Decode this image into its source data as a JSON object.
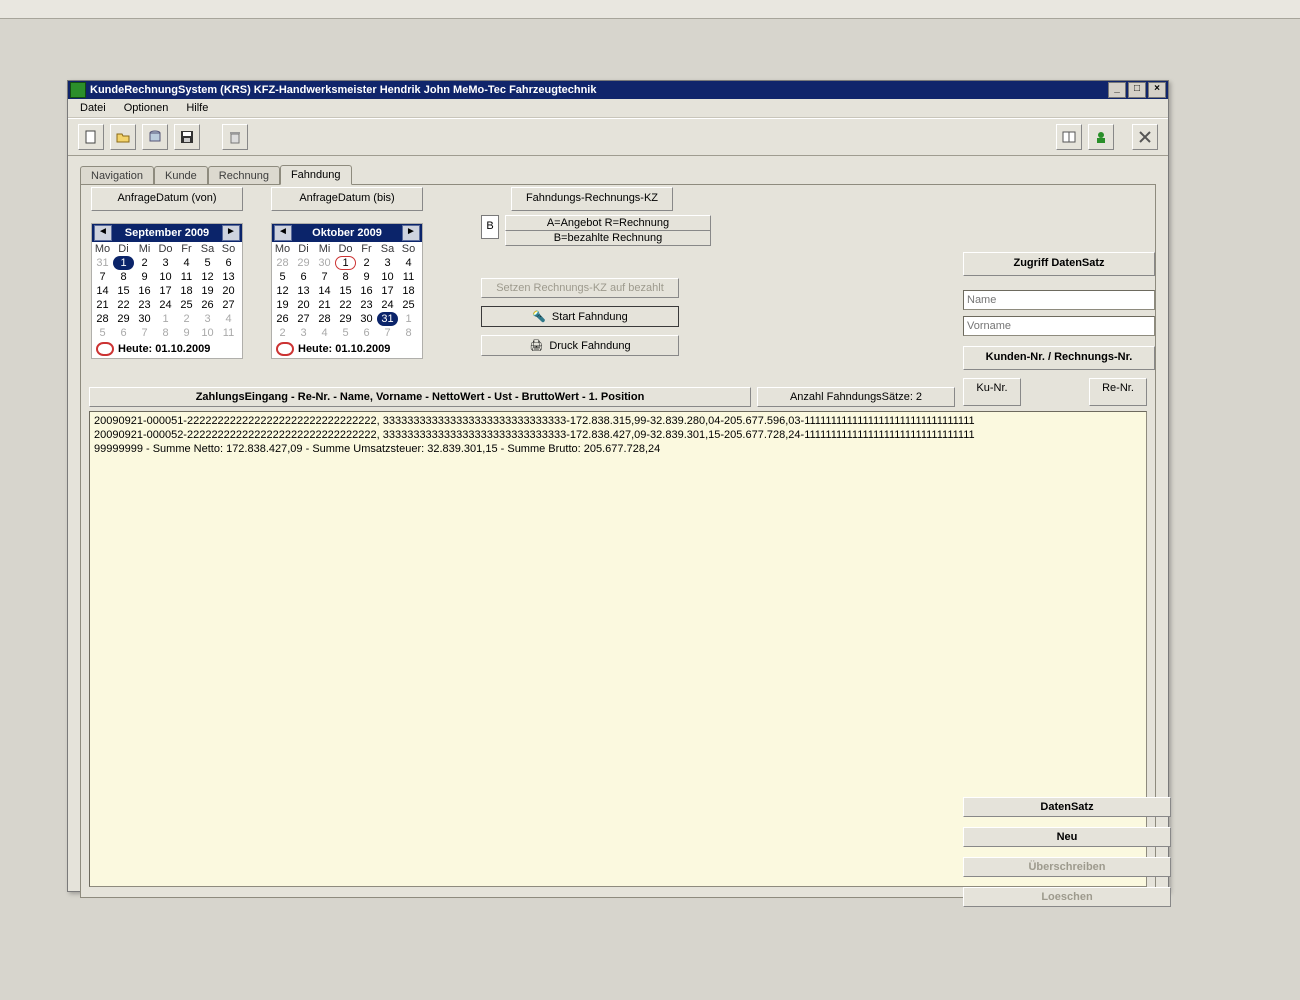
{
  "title": "KundeRechnungSystem (KRS)   KFZ-Handwerksmeister   Hendrik John   MeMo-Tec Fahrzeugtechnik",
  "menu": {
    "datei": "Datei",
    "optionen": "Optionen",
    "hilfe": "Hilfe"
  },
  "tabs": {
    "nav": "Navigation",
    "kunde": "Kunde",
    "rechnung": "Rechnung",
    "fahndung": "Fahndung"
  },
  "von_btn": "AnfrageDatum  (von)",
  "bis_btn": "AnfrageDatum  (bis)",
  "cal_von": {
    "title": "September 2009",
    "dow": [
      "Mo",
      "Di",
      "Mi",
      "Do",
      "Fr",
      "Sa",
      "So"
    ],
    "weeks": [
      [
        {
          "d": "31",
          "g": true
        },
        {
          "d": "1",
          "sel": true
        },
        {
          "d": "2"
        },
        {
          "d": "3"
        },
        {
          "d": "4"
        },
        {
          "d": "5"
        },
        {
          "d": "6"
        }
      ],
      [
        {
          "d": "7"
        },
        {
          "d": "8"
        },
        {
          "d": "9"
        },
        {
          "d": "10"
        },
        {
          "d": "11"
        },
        {
          "d": "12"
        },
        {
          "d": "13"
        }
      ],
      [
        {
          "d": "14"
        },
        {
          "d": "15"
        },
        {
          "d": "16"
        },
        {
          "d": "17"
        },
        {
          "d": "18"
        },
        {
          "d": "19"
        },
        {
          "d": "20"
        }
      ],
      [
        {
          "d": "21"
        },
        {
          "d": "22"
        },
        {
          "d": "23"
        },
        {
          "d": "24"
        },
        {
          "d": "25"
        },
        {
          "d": "26"
        },
        {
          "d": "27"
        }
      ],
      [
        {
          "d": "28"
        },
        {
          "d": "29"
        },
        {
          "d": "30"
        },
        {
          "d": "1",
          "g": true
        },
        {
          "d": "2",
          "g": true
        },
        {
          "d": "3",
          "g": true
        },
        {
          "d": "4",
          "g": true
        }
      ],
      [
        {
          "d": "5",
          "g": true
        },
        {
          "d": "6",
          "g": true
        },
        {
          "d": "7",
          "g": true
        },
        {
          "d": "8",
          "g": true
        },
        {
          "d": "9",
          "g": true
        },
        {
          "d": "10",
          "g": true
        },
        {
          "d": "11",
          "g": true
        }
      ]
    ],
    "today": "Heute: 01.10.2009"
  },
  "cal_bis": {
    "title": "Oktober 2009",
    "dow": [
      "Mo",
      "Di",
      "Mi",
      "Do",
      "Fr",
      "Sa",
      "So"
    ],
    "weeks": [
      [
        {
          "d": "28",
          "g": true
        },
        {
          "d": "29",
          "g": true
        },
        {
          "d": "30",
          "g": true
        },
        {
          "d": "1",
          "today": true
        },
        {
          "d": "2"
        },
        {
          "d": "3"
        },
        {
          "d": "4"
        }
      ],
      [
        {
          "d": "5"
        },
        {
          "d": "6"
        },
        {
          "d": "7"
        },
        {
          "d": "8"
        },
        {
          "d": "9"
        },
        {
          "d": "10"
        },
        {
          "d": "11"
        }
      ],
      [
        {
          "d": "12"
        },
        {
          "d": "13"
        },
        {
          "d": "14"
        },
        {
          "d": "15"
        },
        {
          "d": "16"
        },
        {
          "d": "17"
        },
        {
          "d": "18"
        }
      ],
      [
        {
          "d": "19"
        },
        {
          "d": "20"
        },
        {
          "d": "21"
        },
        {
          "d": "22"
        },
        {
          "d": "23"
        },
        {
          "d": "24"
        },
        {
          "d": "25"
        }
      ],
      [
        {
          "d": "26"
        },
        {
          "d": "27"
        },
        {
          "d": "28"
        },
        {
          "d": "29"
        },
        {
          "d": "30"
        },
        {
          "d": "31",
          "sel": true
        },
        {
          "d": "1",
          "g": true
        }
      ],
      [
        {
          "d": "2",
          "g": true
        },
        {
          "d": "3",
          "g": true
        },
        {
          "d": "4",
          "g": true
        },
        {
          "d": "5",
          "g": true
        },
        {
          "d": "6",
          "g": true
        },
        {
          "d": "7",
          "g": true
        },
        {
          "d": "8",
          "g": true
        }
      ]
    ],
    "today": "Heute: 01.10.2009"
  },
  "kz": {
    "header": "Fahndungs-Rechnungs-KZ",
    "line1": "A=Angebot    R=Rechnung",
    "line2": "B=bezahlte Rechnung",
    "mode": "B",
    "btn_set": "Setzen Rechnungs-KZ auf bezahlt",
    "btn_start": "Start Fahndung",
    "btn_print": "Druck Fahndung"
  },
  "result_header": "ZahlungsEingang - Re-Nr. - Name, Vorname - NettoWert - Ust - BruttoWert - 1. Position",
  "result_count": "Anzahl FahndungsSätze: 2",
  "rows": [
    "20090921-000051-2222222222222222222222222222222, 333333333333333333333333333333-172.838.315,99-32.839.280,04-205.677.596,03-11111111111111111111111111111111",
    "20090921-000052-2222222222222222222222222222222, 333333333333333333333333333333-172.838.427,09-32.839.301,15-205.677.728,24-11111111111111111111111111111111",
    "99999999 - Summe Netto: 172.838.427,09 - Summe Umsatzsteuer: 32.839.301,15 - Summe Brutto: 205.677.728,24"
  ],
  "side": {
    "zugriff": "Zugriff DatenSatz",
    "name_ph": "Name",
    "vorname_ph": "Vorname",
    "kr_header": "Kunden-Nr. / Rechnungs-Nr.",
    "ku": "Ku-Nr.",
    "re": "Re-Nr.",
    "datensatz": "DatenSatz",
    "neu": "Neu",
    "ueber": "Überschreiben",
    "loeschen": "Loeschen"
  }
}
